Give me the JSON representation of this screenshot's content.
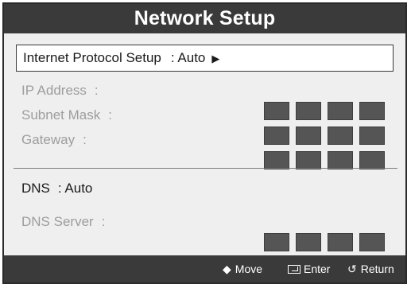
{
  "window": {
    "title": "Network Setup"
  },
  "protocol": {
    "label": "Internet Protocol Setup",
    "value": ": Auto",
    "arrow": "▶"
  },
  "ip_fields": [
    {
      "label": "IP Address",
      "sep": ":"
    },
    {
      "label": "Subnet Mask",
      "sep": ":"
    },
    {
      "label": "Gateway",
      "sep": ":"
    }
  ],
  "dns": {
    "label": "DNS",
    "value": ": Auto"
  },
  "dns_server": {
    "label": "DNS Server",
    "sep": ":"
  },
  "footer": {
    "move_icon": "◆",
    "move_label": "Move",
    "enter_icon": "enter-icon",
    "enter_label": "Enter",
    "return_icon": "↺",
    "return_label": "Return"
  },
  "colors": {
    "bar": "#3a3a3a",
    "panel": "#efefef",
    "field_box": "#555555",
    "disabled_text": "#9d9d9d"
  }
}
